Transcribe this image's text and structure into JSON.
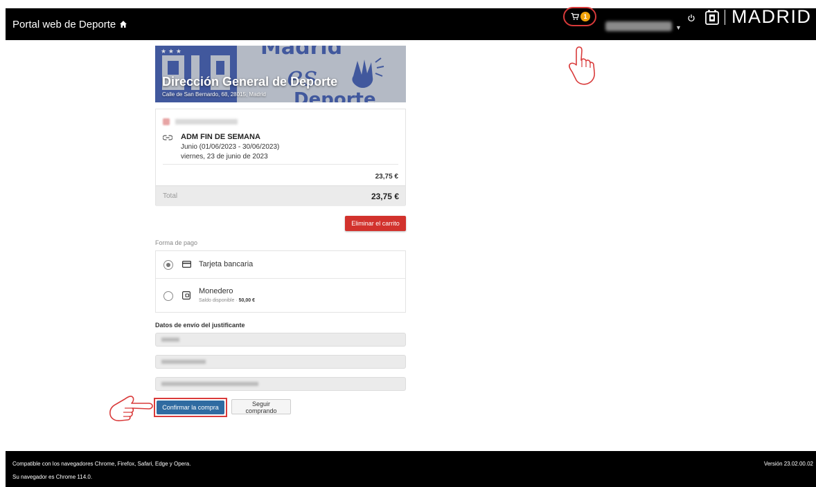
{
  "header": {
    "brand": "Portal web de Deporte",
    "cart_count": "1",
    "city": "MADRID"
  },
  "banner": {
    "title": "Dirección General de Deporte",
    "address": "Calle de San Bernardo, 68, 28015, Madrid"
  },
  "cart": {
    "item": {
      "name": "ADM FIN DE SEMANA",
      "period": "Junio (01/06/2023 - 30/06/2023)",
      "date": "viernes, 23 de junio de 2023",
      "price": "23,75 €"
    },
    "total_label": "Total",
    "total_value": "23,75 €",
    "delete_label": "Eliminar el carrito"
  },
  "payment": {
    "label": "Forma de pago",
    "options": [
      {
        "label": "Tarjeta bancaria",
        "selected": true
      },
      {
        "label": "Monedero",
        "sub_label": "Saldo disponible",
        "balance": "50,00 €",
        "selected": false
      }
    ]
  },
  "shipping": {
    "label": "Datos de envío del justificante"
  },
  "actions": {
    "confirm": "Confirmar la compra",
    "continue": "Seguir comprando"
  },
  "footer": {
    "compat": "Compatible con los navegadores Chrome, Firefox, Safari, Edge y Opera.",
    "browser": "Su navegador es Chrome 114.0.",
    "version": "Versión 23.02.00.02"
  },
  "colors": {
    "navbar": "#000000",
    "annotation_red": "#d93a3a",
    "confirm_blue": "#2f6ba1",
    "delete_red": "#d2322d",
    "badge_orange": "#f0a30a"
  }
}
